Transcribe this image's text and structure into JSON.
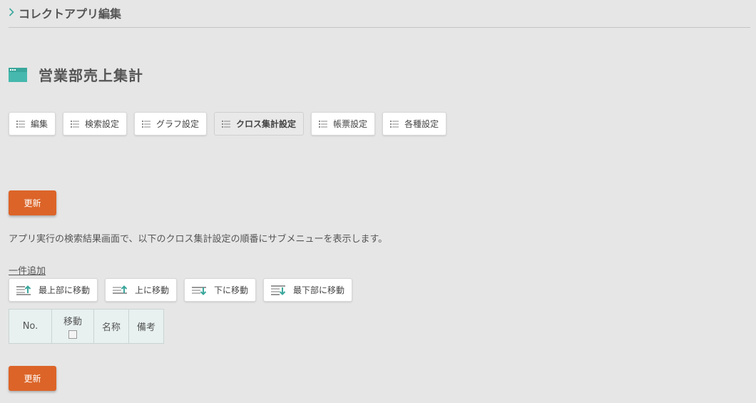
{
  "breadcrumb": {
    "label": "コレクトアプリ編集"
  },
  "page": {
    "title": "営業部売上集計"
  },
  "tabs": [
    {
      "label": "編集",
      "active": false
    },
    {
      "label": "検索設定",
      "active": false
    },
    {
      "label": "グラフ設定",
      "active": false
    },
    {
      "label": "クロス集計設定",
      "active": true
    },
    {
      "label": "帳票設定",
      "active": false
    },
    {
      "label": "各種設定",
      "active": false
    }
  ],
  "actions": {
    "update_label": "更新",
    "add_one_label": "一件追加"
  },
  "description": "アプリ実行の検索結果画面で、以下のクロス集計設定の順番にサブメニューを表示します。",
  "move_buttons": {
    "top": "最上部に移動",
    "up": "上に移動",
    "down": "下に移動",
    "bottom": "最下部に移動"
  },
  "table": {
    "headers": {
      "no": "No.",
      "move": "移動",
      "name": "名称",
      "note": "備考"
    },
    "rows": []
  },
  "colors": {
    "accent_orange": "#dc6428",
    "accent_teal": "#3aa79c",
    "background": "#e6e6e6",
    "table_header": "#e8f1f0"
  }
}
